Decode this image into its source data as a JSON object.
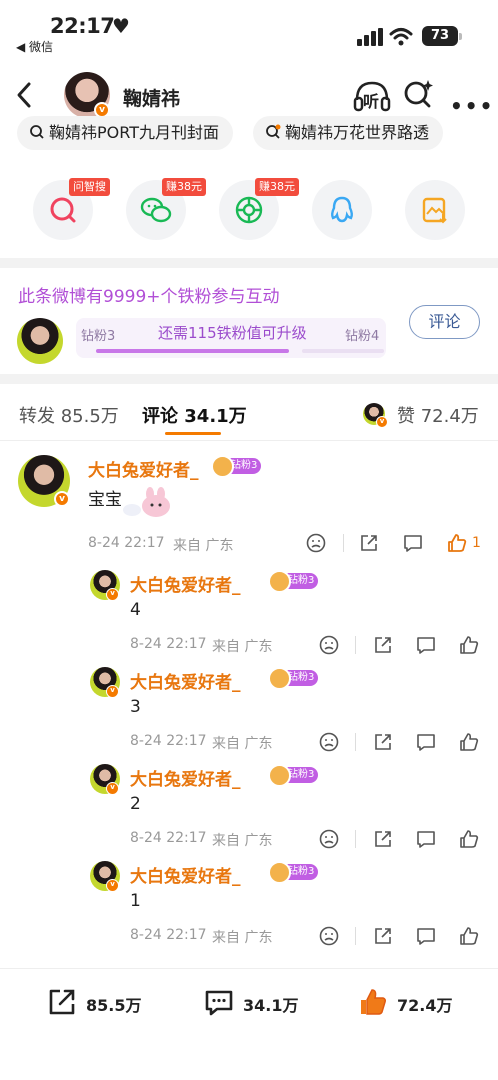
{
  "status_bar": {
    "time": "22:17",
    "heart": "♥",
    "back_app": "◀ 微信",
    "battery": "73"
  },
  "nav": {
    "user_name": "鞠婧祎",
    "listen_label": "听"
  },
  "search_chips": [
    "鞠婧祎PORT九月刊封面",
    "鞠婧祎万花世界路透"
  ],
  "share_buttons": [
    {
      "icon": "wenzhisou-icon",
      "tag": "问智搜"
    },
    {
      "icon": "wechat-icon",
      "tag": "赚38元"
    },
    {
      "icon": "moments-icon",
      "tag": "赚38元"
    },
    {
      "icon": "qq-icon",
      "tag": ""
    },
    {
      "icon": "save-image-icon",
      "tag": ""
    }
  ],
  "fan": {
    "title": "此条微博有9999+个铁粉参与互动",
    "current_level": "钻粉3",
    "next_level": "钻粉4",
    "need_text": "还需115铁粉值可升级",
    "progress": 0.67,
    "button": "评论"
  },
  "tabs": {
    "repost": "转发 85.5万",
    "comment": "评论 34.1万",
    "like": "赞 72.4万"
  },
  "comments": [
    {
      "name": "大白兔爱好者_",
      "level": "钻粉3",
      "text": "宝宝",
      "time": "8-24 22:17",
      "loc": "来自 广东",
      "likes": "1"
    }
  ],
  "replies": [
    {
      "name": "大白兔爱好者_",
      "level": "钻粉3",
      "text": "4",
      "time": "8-24 22:17",
      "loc": "来自 广东"
    },
    {
      "name": "大白兔爱好者_",
      "level": "钻粉3",
      "text": "3",
      "time": "8-24 22:17",
      "loc": "来自 广东"
    },
    {
      "name": "大白兔爱好者_",
      "level": "钻粉3",
      "text": "2",
      "time": "8-24 22:17",
      "loc": "来自 广东"
    },
    {
      "name": "大白兔爱好者_",
      "level": "钻粉3",
      "text": "1",
      "time": "8-24 22:17",
      "loc": "来自 广东"
    }
  ],
  "bottom": {
    "repost": "85.5万",
    "comment": "34.1万",
    "like": "72.4万"
  },
  "colors": {
    "accent_orange": "#f47a00",
    "fan_purple": "#b14fd6",
    "tag_red": "#f24c3d"
  }
}
